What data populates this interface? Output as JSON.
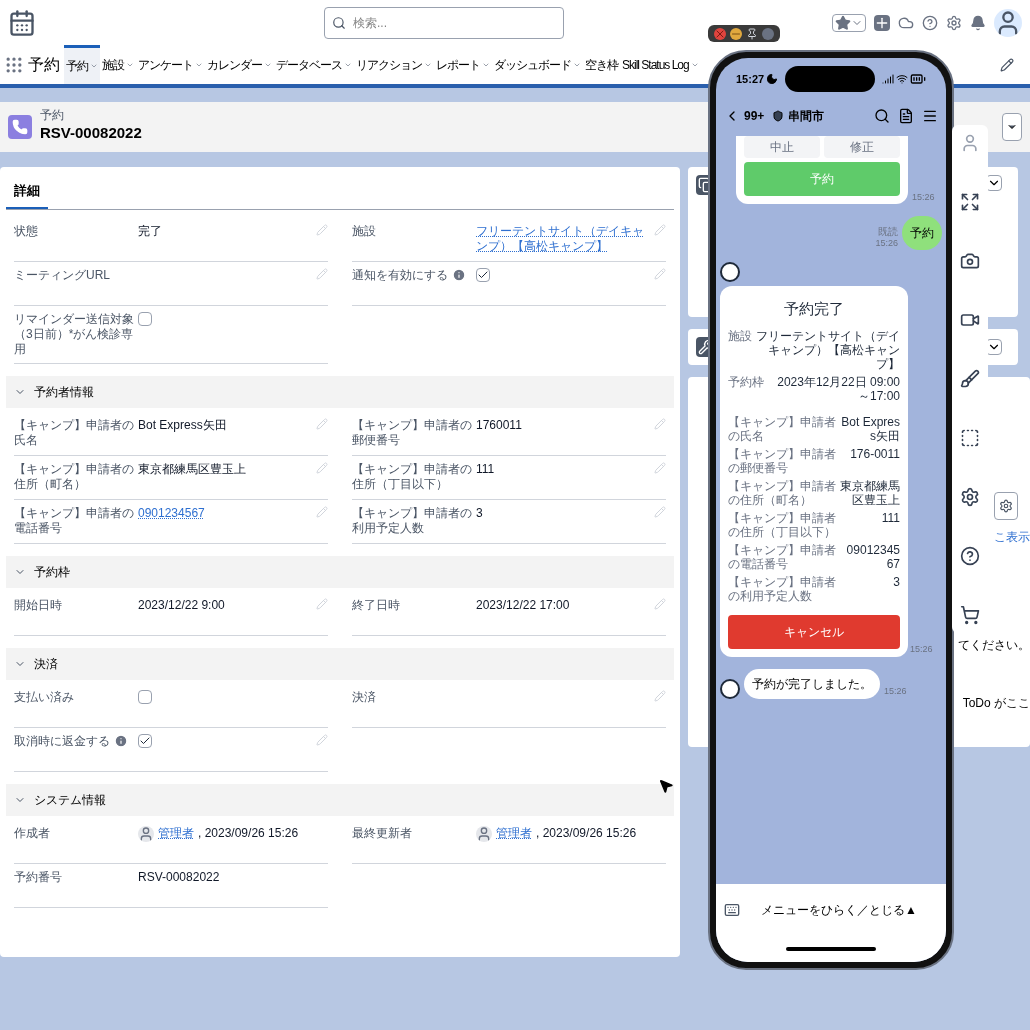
{
  "app_bar": {
    "search": {
      "placeholder": "検索..."
    }
  },
  "nav": {
    "app_name": "予約",
    "tabs": [
      {
        "label": "予約",
        "selected": true,
        "has_menu": true
      },
      {
        "label": "施設",
        "selected": false,
        "has_menu": true
      },
      {
        "label": "アンケート",
        "selected": false,
        "has_menu": true
      },
      {
        "label": "カレンダー",
        "selected": false,
        "has_menu": true
      },
      {
        "label": "データベース",
        "selected": false,
        "has_menu": true
      },
      {
        "label": "リアクション",
        "selected": false,
        "has_menu": true
      },
      {
        "label": "レポート",
        "selected": false,
        "has_menu": true
      },
      {
        "label": "ダッシュボード",
        "selected": false,
        "has_menu": true
      },
      {
        "label": "空き枠",
        "selected": false,
        "has_menu": false
      },
      {
        "label": "Skill Status Log",
        "selected": false,
        "has_menu": true
      }
    ]
  },
  "record": {
    "object": "予約",
    "name": "RSV-00082022"
  },
  "detail": {
    "tabs": [
      {
        "label": "詳細",
        "selected": true
      }
    ],
    "sections": [
      {
        "rows": [
          [
            {
              "label": "状態",
              "kind": "text",
              "value": "完了",
              "editable": true
            },
            {
              "label": "施設",
              "kind": "link",
              "value": "フリーテントサイト（デイキャンプ）【高松キャンプ】",
              "editable": true
            }
          ],
          [
            {
              "label": "ミーティングURL",
              "kind": "text",
              "editable": true
            },
            {
              "label": "通知を有効にする",
              "kind": "checkbox",
              "checked": true,
              "info": true,
              "editable": true
            }
          ],
          [
            {
              "label": "リマインダー送信対象（3日前）*がん検診専用",
              "kind": "checkbox",
              "checked": false,
              "editable": false
            }
          ]
        ]
      },
      {
        "title": "予約者情報",
        "expanded": true,
        "rows": [
          [
            {
              "label": "【キャンプ】申請者の氏名",
              "kind": "text",
              "value": "Bot Express矢田",
              "editable": true
            },
            {
              "label": "【キャンプ】申請者の郵便番号",
              "kind": "text",
              "value": "1760011",
              "editable": true
            }
          ],
          [
            {
              "label": "【キャンプ】申請者の住所（町名）",
              "kind": "text",
              "value": "東京都練馬区豊玉上",
              "editable": true
            },
            {
              "label": "【キャンプ】申請者の住所（丁目以下）",
              "kind": "text",
              "value": "111",
              "editable": true
            }
          ],
          [
            {
              "label": "【キャンプ】申請者の電話番号",
              "kind": "link",
              "value": "0901234567",
              "editable": true
            },
            {
              "label": "【キャンプ】申請者の利用予定人数",
              "kind": "text",
              "value": "3",
              "editable": true
            }
          ]
        ]
      },
      {
        "title": "予約枠",
        "expanded": true,
        "rows": [
          [
            {
              "label": "開始日時",
              "kind": "text",
              "value": "2023/12/22 9:00",
              "editable": true
            },
            {
              "label": "終了日時",
              "kind": "text",
              "value": "2023/12/22 17:00",
              "editable": true
            }
          ]
        ]
      },
      {
        "title": "決済",
        "expanded": true,
        "rows": [
          [
            {
              "label": "支払い済み",
              "kind": "checkbox",
              "checked": false,
              "editable": false
            },
            {
              "label": "決済",
              "kind": "text",
              "editable": true
            }
          ],
          [
            {
              "label": "取消時に返金する",
              "kind": "checkbox",
              "checked": true,
              "info": true,
              "editable": true
            }
          ]
        ]
      },
      {
        "title": "システム情報",
        "expanded": true,
        "rows": [
          [
            {
              "label": "作成者",
              "kind": "user",
              "user": "管理者",
              "value": ", 2023/09/26 15:26",
              "editable": false
            },
            {
              "label": "最終更新者",
              "kind": "user",
              "user": "管理者",
              "value": ", 2023/09/26 15:26",
              "editable": false
            }
          ],
          [
            {
              "label": "予約番号",
              "kind": "text",
              "value": "RSV-00082022",
              "editable": false
            }
          ]
        ]
      }
    ]
  },
  "side_panel": {
    "link": "こ表示",
    "message": "てください。",
    "todo": "ToDo がここ"
  },
  "phone": {
    "time": "15:27",
    "back_count": "99+",
    "chat_title": "串間市",
    "messages": [
      {
        "kind": "buttons_card",
        "buttons": [
          "中止",
          "修正"
        ],
        "main_button": "予約",
        "time": "15:26"
      },
      {
        "kind": "user_text",
        "text": "予約",
        "read": "既読",
        "time": "15:26"
      },
      {
        "kind": "result_card",
        "title": "予約完了",
        "summary_rows": [
          {
            "label": "施設",
            "value": "フリーテントサイト（デイキャンプ）【高松キャンプ】"
          },
          {
            "label": "予約枠",
            "value": "2023年12月22日 09:00～17:00"
          }
        ],
        "detail_rows": [
          {
            "label": "【キャンプ】申請者の氏名",
            "value": "Bot Express矢田"
          },
          {
            "label": "【キャンプ】申請者の郵便番号",
            "value": "176-0011"
          },
          {
            "label": "【キャンプ】申請者の住所（町名）",
            "value": "東京都練馬区豊玉上"
          },
          {
            "label": "【キャンプ】申請者の住所（丁目以下）",
            "value": "111"
          },
          {
            "label": "【キャンプ】申請者の電話番号",
            "value": "09012345 67"
          },
          {
            "label": "【キャンプ】申請者の利用予定人数",
            "value": "3"
          }
        ],
        "button": "キャンセル",
        "time": "15:26"
      },
      {
        "kind": "bot_text",
        "text": "予約が完了しました。",
        "time": "15:26"
      }
    ],
    "menu": "メニューをひらく／とじる▲"
  }
}
